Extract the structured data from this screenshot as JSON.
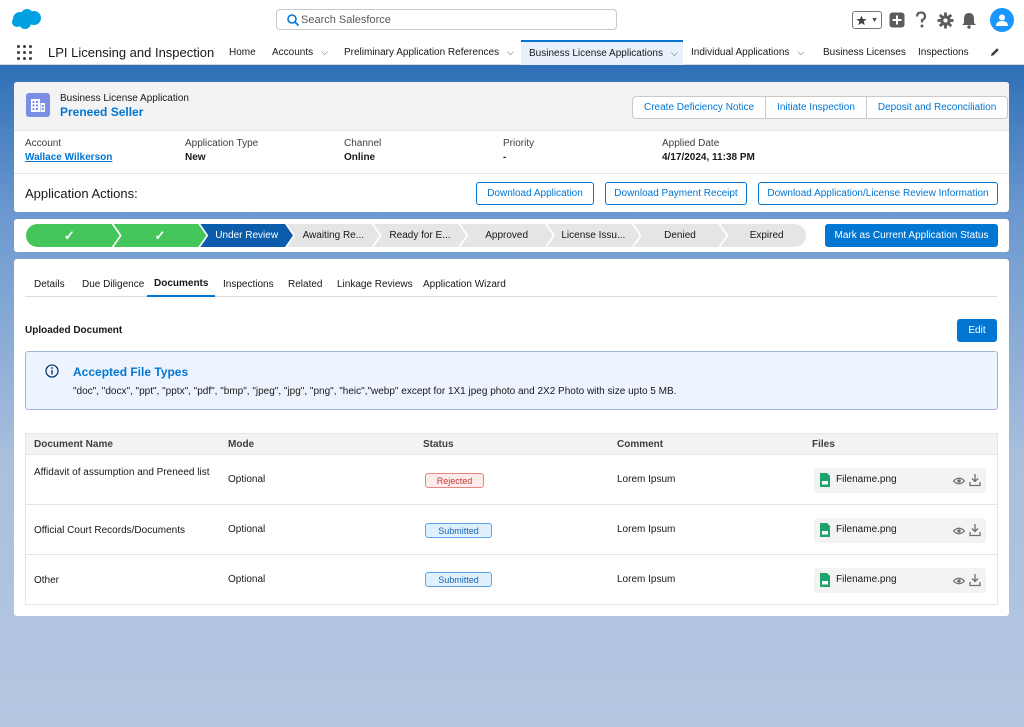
{
  "global_header": {
    "search_placeholder": "Search Salesforce"
  },
  "nav": {
    "app_name": "LPI Licensing and Inspection",
    "items": [
      {
        "label": "Home",
        "has_menu": false
      },
      {
        "label": "Accounts",
        "has_menu": true
      },
      {
        "label": "Preliminary Application References",
        "has_menu": true
      },
      {
        "label": "Business License Applications",
        "has_menu": true,
        "active": true
      },
      {
        "label": "Individual Applications",
        "has_menu": true
      },
      {
        "label": "Business Licenses",
        "has_menu": false
      },
      {
        "label": "Inspections",
        "has_menu": false
      }
    ]
  },
  "record": {
    "object_type": "Business License Application",
    "name": "Preneed Seller",
    "header_actions": [
      "Create Deficiency Notice",
      "Initiate Inspection",
      "Deposit and Reconciliation"
    ],
    "fields": [
      {
        "label": "Account",
        "value": "Wallace Wilkerson",
        "link": true
      },
      {
        "label": "Application Type",
        "value": "New"
      },
      {
        "label": "Channel",
        "value": "Online"
      },
      {
        "label": "Priority",
        "value": "-"
      },
      {
        "label": "Applied Date",
        "value": "4/17/2024, 11:38 PM"
      }
    ],
    "actions_title": "Application Actions:",
    "actions": [
      "Download Application",
      "Download Payment Receipt",
      "Download Application/License Review Information"
    ]
  },
  "path": {
    "stages": [
      {
        "label": "✓",
        "state": "complete"
      },
      {
        "label": "✓",
        "state": "complete"
      },
      {
        "label": "Under Review",
        "state": "current"
      },
      {
        "label": "Awaiting Re...",
        "state": "incomplete"
      },
      {
        "label": "Ready for E...",
        "state": "incomplete"
      },
      {
        "label": "Approved",
        "state": "incomplete"
      },
      {
        "label": "License Issu...",
        "state": "incomplete"
      },
      {
        "label": "Denied",
        "state": "incomplete"
      },
      {
        "label": "Expired",
        "state": "incomplete"
      }
    ],
    "mark_button": "Mark as Current Application Status"
  },
  "tabs": [
    {
      "label": "Details"
    },
    {
      "label": "Due Diligence"
    },
    {
      "label": "Documents",
      "active": true
    },
    {
      "label": "Inspections"
    },
    {
      "label": "Related"
    },
    {
      "label": "Linkage Reviews"
    },
    {
      "label": "Application Wizard"
    }
  ],
  "documents": {
    "section_title": "Uploaded Document",
    "edit_label": "Edit",
    "info_title": "Accepted File Types",
    "info_text": "\"doc\", \"docx\", \"ppt\", \"pptx\", \"pdf\", \"bmp\", \"jpeg\", \"jpg\", \"png\", \"heic\",\"webp\" except for 1X1 jpeg photo and 2X2 Photo with size upto 5 MB.",
    "columns": [
      "Document Name",
      "Mode",
      "Status",
      "Comment",
      "Files"
    ],
    "rows": [
      {
        "name": "Affidavit of assumption and Preneed list",
        "mode": "Optional",
        "status": "Rejected",
        "comment": "Lorem Ipsum",
        "file": "Filename.png"
      },
      {
        "name": "Official Court Records/Documents",
        "mode": "Optional",
        "status": "Submitted",
        "comment": "Lorem Ipsum",
        "file": "Filename.png"
      },
      {
        "name": "Other",
        "mode": "Optional",
        "status": "Submitted",
        "comment": "Lorem Ipsum",
        "file": "Filename.png"
      }
    ]
  },
  "colors": {
    "brand": "#0176d3",
    "path_complete": "#45c65a",
    "path_current": "#0b5cab",
    "path_incomplete": "#e5e5e5",
    "rejected": "#c23934",
    "submitted": "#1765b5"
  },
  "icons": [
    "salesforce-cloud-icon",
    "search-icon",
    "favorites-star-icon",
    "add-icon",
    "help-icon",
    "setup-gear-icon",
    "notifications-bell-icon",
    "user-avatar-icon",
    "app-launcher-icon",
    "edit-pencil-icon",
    "building-icon",
    "info-icon",
    "file-icon",
    "preview-eye-icon",
    "download-icon",
    "checkmark-icon"
  ]
}
